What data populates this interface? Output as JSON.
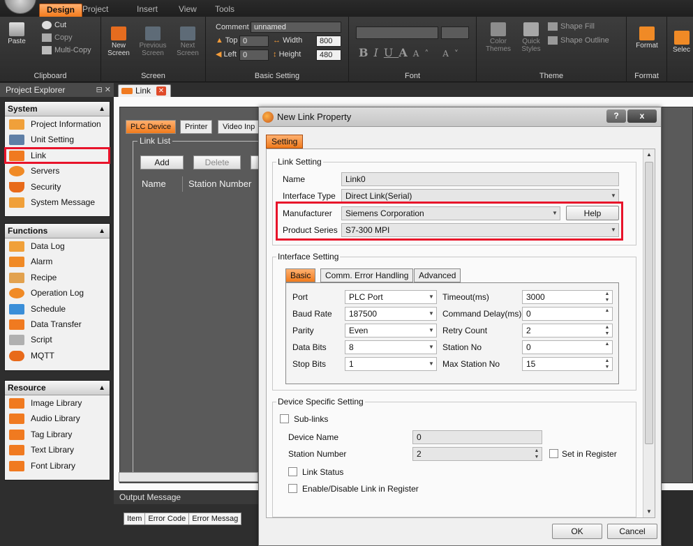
{
  "ribbon": {
    "tabs": [
      "Design",
      "Project",
      "Insert",
      "View",
      "Tools"
    ],
    "active_tab": "Design",
    "clipboard": {
      "cut": "Cut",
      "copy": "Copy",
      "paste": "Paste",
      "multi_copy": "Multi-Copy",
      "label": "Clipboard"
    },
    "screen": {
      "new": "New",
      "new2": "Screen",
      "previous": "Previous",
      "previous2": "Screen",
      "next": "Next",
      "next2": "Screen",
      "label": "Screen"
    },
    "basic": {
      "comment_label": "Comment",
      "comment_value": "unnamed",
      "top_label": "Top",
      "top_value": "0",
      "left_label": "Left",
      "left_value": "0",
      "width_label": "Width",
      "width_value": "800",
      "height_label": "Height",
      "height_value": "480",
      "label": "Basic Setting"
    },
    "font": {
      "label": "Font",
      "bold": "B",
      "italic": "I",
      "underline": "U",
      "color": "A",
      "grow": "A˄ A˅"
    },
    "theme": {
      "color_themes": "Color",
      "color_themes2": "Themes",
      "quick_styles": "Quick",
      "quick_styles2": "Styles",
      "shape_fill": "Shape Fill",
      "shape_outline": "Shape Outline",
      "label": "Theme"
    },
    "format": {
      "format": "Format",
      "label": "Format",
      "select": "Selec"
    }
  },
  "explorer": {
    "title": "Project Explorer",
    "system": {
      "title": "System",
      "items": [
        "Project Information",
        "Unit Setting",
        "Link",
        "Servers",
        "Security",
        "System Message"
      ]
    },
    "functions": {
      "title": "Functions",
      "items": [
        "Data Log",
        "Alarm",
        "Recipe",
        "Operation Log",
        "Schedule",
        "Data Transfer",
        "Script",
        "MQTT"
      ]
    },
    "resource": {
      "title": "Resource",
      "items": [
        "Image Library",
        "Audio Library",
        "Tag Library",
        "Text Library",
        "Font Library"
      ]
    }
  },
  "document": {
    "tab_label": "Link",
    "subtabs": [
      "PLC Device",
      "Printer",
      "Video Inp"
    ],
    "link_list_label": "Link List",
    "add_label": "Add",
    "delete_label": "Delete",
    "columns": [
      "Name",
      "Station Number"
    ]
  },
  "output": {
    "title": "Output Message",
    "columns": [
      "Item",
      "Error Code",
      "Error Messag"
    ]
  },
  "dialog": {
    "title": "New Link Property",
    "help_title": "?",
    "close_title": "x",
    "tab": "Setting",
    "link_setting": {
      "legend": "Link Setting",
      "name_label": "Name",
      "name_value": "Link0",
      "interface_label": "Interface Type",
      "interface_value": "Direct Link(Serial)",
      "manufacturer_label": "Manufacturer",
      "manufacturer_value": "Siemens Corporation",
      "help_label": "Help",
      "product_label": "Product Series",
      "product_value": "S7-300 MPI"
    },
    "interface_setting": {
      "legend": "Interface Setting",
      "tabs": [
        "Basic",
        "Comm. Error Handling",
        "Advanced"
      ],
      "port_label": "Port",
      "port_value": "PLC Port",
      "baud_label": "Baud Rate",
      "baud_value": "187500",
      "parity_label": "Parity",
      "parity_value": "Even",
      "databits_label": "Data Bits",
      "databits_value": "8",
      "stopbits_label": "Stop Bits",
      "stopbits_value": "1",
      "timeout_label": "Timeout(ms)",
      "timeout_value": "3000",
      "cmddelay_label": "Command Delay(ms)",
      "cmddelay_value": "0",
      "retry_label": "Retry Count",
      "retry_value": "2",
      "station_label": "Station No",
      "station_value": "0",
      "maxstation_label": "Max Station No",
      "maxstation_value": "15"
    },
    "device_setting": {
      "legend": "Device Specific Setting",
      "sublinks_label": "Sub-links",
      "device_name_label": "Device Name",
      "device_name_value": "0",
      "station_number_label": "Station Number",
      "station_number_value": "2",
      "set_in_register_label": "Set in Register",
      "link_status_label": "Link Status",
      "enable_disable_label": "Enable/Disable Link in Register"
    },
    "ok_label": "OK",
    "cancel_label": "Cancel"
  },
  "colors": {
    "accent": "#f07a1c",
    "highlight": "#e8132a"
  }
}
